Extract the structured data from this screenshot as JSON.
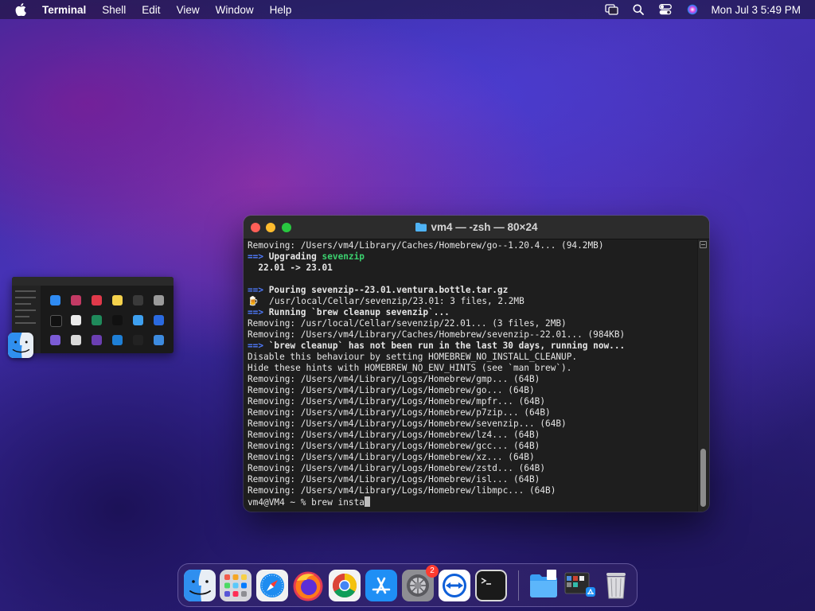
{
  "menubar": {
    "app_name": "Terminal",
    "menus": [
      "Shell",
      "Edit",
      "View",
      "Window",
      "Help"
    ],
    "status_icons": [
      "screen-mirroring-icon",
      "spotlight-search-icon",
      "control-center-icon",
      "siri-icon"
    ],
    "clock": "Mon Jul 3  5:49 PM"
  },
  "terminal": {
    "title": "vm4 — -zsh — 80×24",
    "lines": [
      {
        "segments": [
          {
            "text": "Removing: /Users/vm4/Library/Caches/Homebrew/go--1.20.4... (94.2MB)",
            "style": "normal"
          }
        ]
      },
      {
        "segments": [
          {
            "text": "==>",
            "style": "arrow"
          },
          {
            "text": " Upgrading ",
            "style": "bold"
          },
          {
            "text": "sevenzip",
            "style": "green"
          }
        ]
      },
      {
        "segments": [
          {
            "text": "  22.01 -> 23.01",
            "style": "bold"
          }
        ]
      },
      {
        "segments": [
          {
            "text": "",
            "style": "normal"
          }
        ]
      },
      {
        "segments": [
          {
            "text": "==>",
            "style": "arrow"
          },
          {
            "text": " Pouring sevenzip--23.01.ventura.bottle.tar.gz",
            "style": "bold"
          }
        ]
      },
      {
        "segments": [
          {
            "text": "🍺",
            "style": "normal"
          },
          {
            "text": "  /usr/local/Cellar/sevenzip/23.01: 3 files, 2.2MB",
            "style": "normal"
          }
        ]
      },
      {
        "segments": [
          {
            "text": "==>",
            "style": "arrow"
          },
          {
            "text": " Running `brew cleanup sevenzip`...",
            "style": "bold"
          }
        ]
      },
      {
        "segments": [
          {
            "text": "Removing: /usr/local/Cellar/sevenzip/22.01... (3 files, 2MB)",
            "style": "normal"
          }
        ]
      },
      {
        "segments": [
          {
            "text": "Removing: /Users/vm4/Library/Caches/Homebrew/sevenzip--22.01... (984KB)",
            "style": "normal"
          }
        ]
      },
      {
        "segments": [
          {
            "text": "==>",
            "style": "arrow"
          },
          {
            "text": " `brew cleanup` has not been run in the last 30 days, running now...",
            "style": "bold"
          }
        ]
      },
      {
        "segments": [
          {
            "text": "Disable this behaviour by setting HOMEBREW_NO_INSTALL_CLEANUP.",
            "style": "normal"
          }
        ]
      },
      {
        "segments": [
          {
            "text": "Hide these hints with HOMEBREW_NO_ENV_HINTS (see `man brew`).",
            "style": "normal"
          }
        ]
      },
      {
        "segments": [
          {
            "text": "Removing: /Users/vm4/Library/Logs/Homebrew/gmp... (64B)",
            "style": "normal"
          }
        ]
      },
      {
        "segments": [
          {
            "text": "Removing: /Users/vm4/Library/Logs/Homebrew/go... (64B)",
            "style": "normal"
          }
        ]
      },
      {
        "segments": [
          {
            "text": "Removing: /Users/vm4/Library/Logs/Homebrew/mpfr... (64B)",
            "style": "normal"
          }
        ]
      },
      {
        "segments": [
          {
            "text": "Removing: /Users/vm4/Library/Logs/Homebrew/p7zip... (64B)",
            "style": "normal"
          }
        ]
      },
      {
        "segments": [
          {
            "text": "Removing: /Users/vm4/Library/Logs/Homebrew/sevenzip... (64B)",
            "style": "normal"
          }
        ]
      },
      {
        "segments": [
          {
            "text": "Removing: /Users/vm4/Library/Logs/Homebrew/lz4... (64B)",
            "style": "normal"
          }
        ]
      },
      {
        "segments": [
          {
            "text": "Removing: /Users/vm4/Library/Logs/Homebrew/gcc... (64B)",
            "style": "normal"
          }
        ]
      },
      {
        "segments": [
          {
            "text": "Removing: /Users/vm4/Library/Logs/Homebrew/xz... (64B)",
            "style": "normal"
          }
        ]
      },
      {
        "segments": [
          {
            "text": "Removing: /Users/vm4/Library/Logs/Homebrew/zstd... (64B)",
            "style": "normal"
          }
        ]
      },
      {
        "segments": [
          {
            "text": "Removing: /Users/vm4/Library/Logs/Homebrew/isl... (64B)",
            "style": "normal"
          }
        ]
      },
      {
        "segments": [
          {
            "text": "Removing: /Users/vm4/Library/Logs/Homebrew/libmpc... (64B)",
            "style": "normal"
          }
        ]
      }
    ],
    "prompt": "vm4@VM4 ~ % ",
    "input": "brew insta"
  },
  "dock": {
    "apps": [
      {
        "name": "finder-icon"
      },
      {
        "name": "launchpad-icon"
      },
      {
        "name": "safari-icon"
      },
      {
        "name": "firefox-icon"
      },
      {
        "name": "chrome-icon"
      },
      {
        "name": "app-store-icon"
      },
      {
        "name": "system-settings-icon",
        "badge": "2"
      },
      {
        "name": "teamviewer-icon"
      },
      {
        "name": "terminal-icon"
      }
    ],
    "others": [
      {
        "name": "downloads-folder-icon"
      },
      {
        "name": "applications-stack-icon"
      },
      {
        "name": "trash-icon"
      }
    ]
  },
  "colors": {
    "terminal_bg": "#1e1e1e",
    "arrow_blue": "#4f7bff",
    "highlight_green": "#3bd16f",
    "badge_red": "#ff3b30"
  }
}
